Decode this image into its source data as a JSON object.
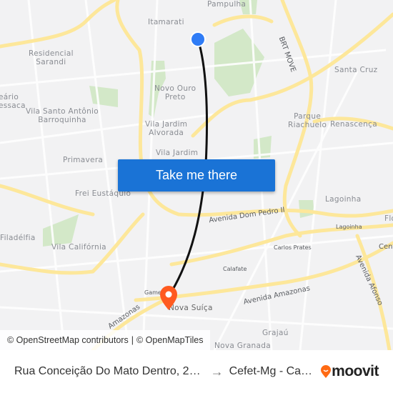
{
  "map": {
    "labels": [
      "Pampulha",
      "Itamarati",
      "Residencial\nSarandi",
      "eário\nessaca",
      "Vila Santo Antônio\nBarroquinha",
      "Novo Ouro\nPreto",
      "Vila Jardim\nAlvorada",
      "Vila Jardim",
      "Primavera",
      "Frei Eustáquio",
      "Filadélfia",
      "Vila Califórnia",
      "Santa Cruz",
      "Parque\nRiachuelo",
      "Renascença",
      "Lagoinha",
      "Lagoinha",
      "Carlos Prates",
      "Calafate",
      "Gameleira",
      "Nova Suíça",
      "Grajaú",
      "Nova Granada",
      "Flo",
      "Cent"
    ],
    "roads": [
      "BRT MOVE",
      "Avenida Dom Pedro II",
      "Avenida Amazonas",
      "Avenida Afonso",
      "Amazonas"
    ],
    "colors": {
      "route": "#111111",
      "origin": "#2f7cf6",
      "destination": "#ff5a1f",
      "button": "#1a73d6",
      "road": "#fde79a",
      "park": "#d3e8c8"
    }
  },
  "cta_label": "Take me there",
  "attribution": {
    "osm_contrib": "© OpenStreetMap contributors",
    "separator": "|",
    "omt": "© OpenMapTiles"
  },
  "footer": {
    "origin": "Rua Conceição Do Mato Dentro, 2…",
    "arrow": "→",
    "destination": "Cefet-Mg - Ca…",
    "brand": "moovit"
  }
}
